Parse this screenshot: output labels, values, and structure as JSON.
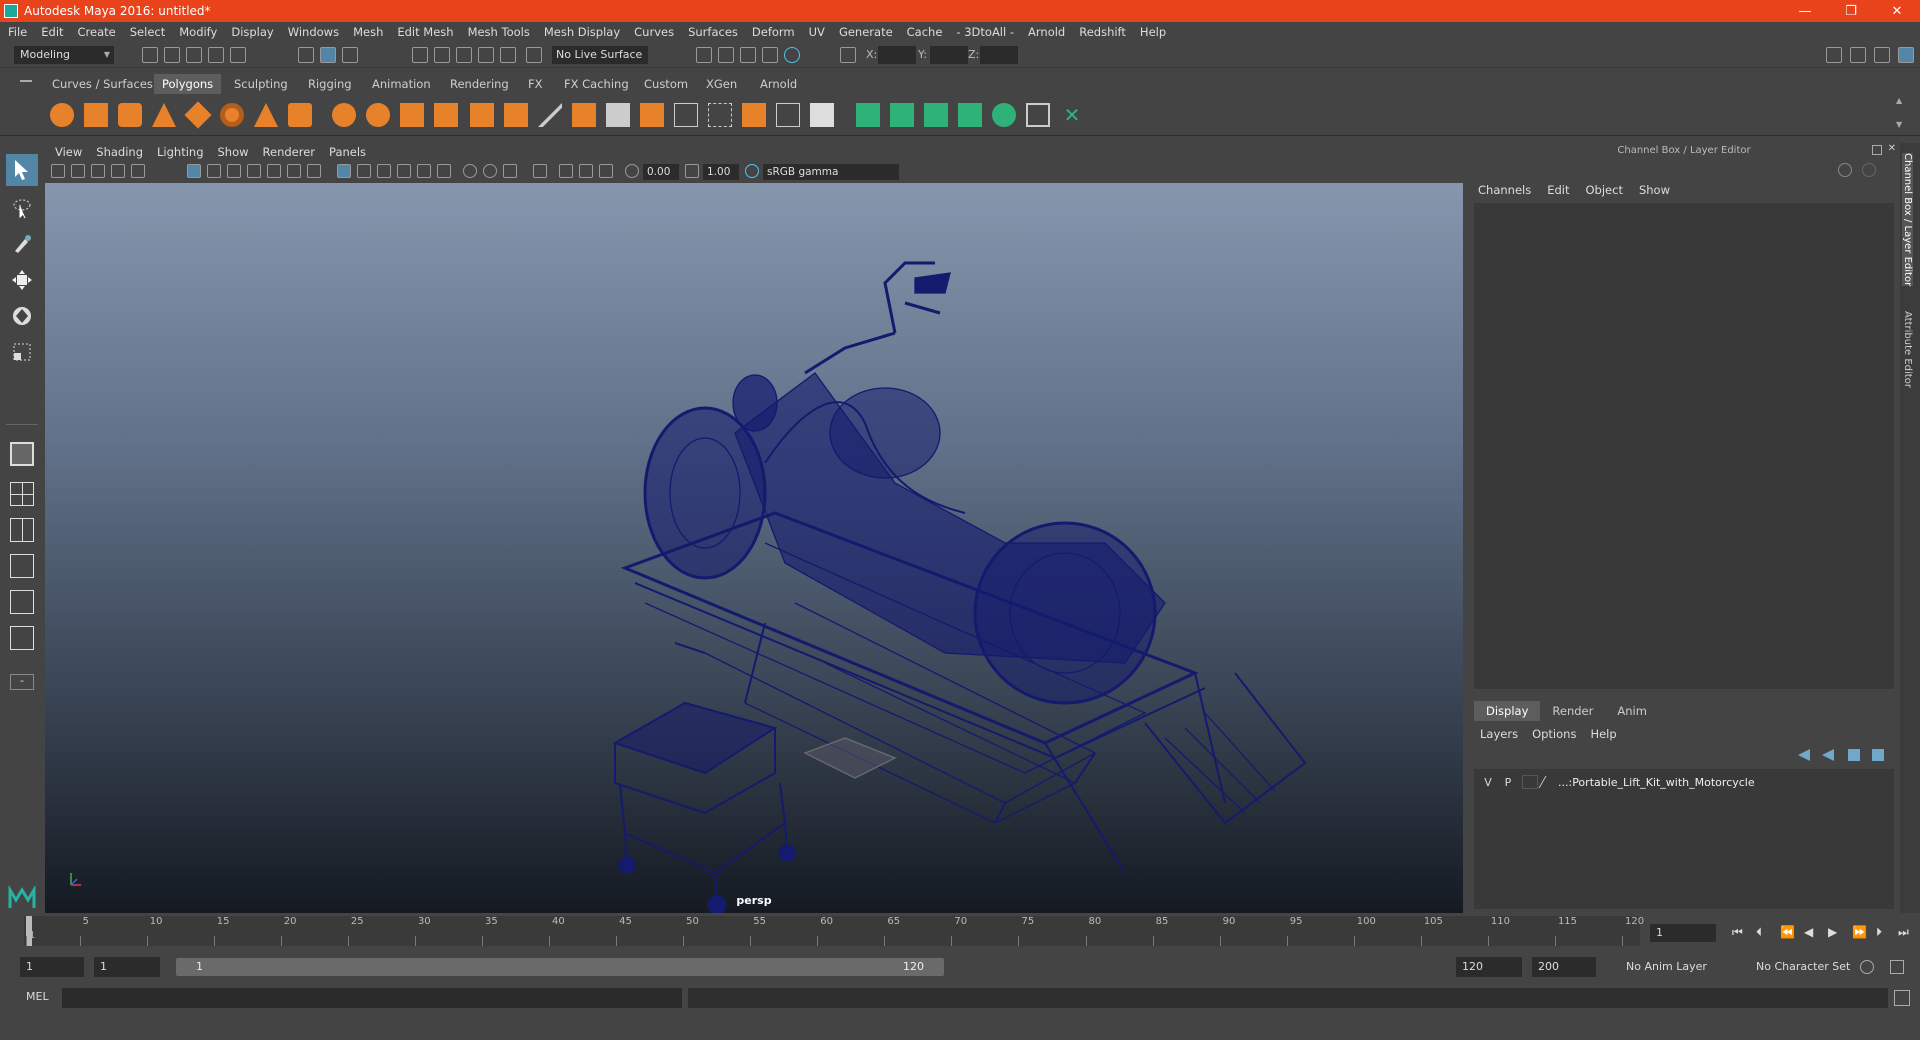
{
  "window": {
    "title": "Autodesk Maya 2016: untitled*",
    "min": "—",
    "restore": "❐",
    "close": "✕"
  },
  "menubar": [
    "File",
    "Edit",
    "Create",
    "Select",
    "Modify",
    "Display",
    "Windows",
    "Mesh",
    "Edit Mesh",
    "Mesh Tools",
    "Mesh Display",
    "Curves",
    "Surfaces",
    "Deform",
    "UV",
    "Generate",
    "Cache",
    "- 3DtoAll -",
    "Arnold",
    "Redshift",
    "Help"
  ],
  "status": {
    "mode": "Modeling",
    "live_surface": "No Live Surface",
    "x_label": "X:",
    "y_label": "Y:",
    "z_label": "Z:"
  },
  "shelf": {
    "tabs": [
      "Curves / Surfaces",
      "Polygons",
      "Sculpting",
      "Rigging",
      "Animation",
      "Rendering",
      "FX",
      "FX Caching",
      "Custom",
      "XGen",
      "Arnold"
    ],
    "active_tab": "Polygons"
  },
  "viewport": {
    "menus": [
      "View",
      "Shading",
      "Lighting",
      "Show",
      "Renderer",
      "Panels"
    ],
    "exposure": "0.00",
    "gamma": "1.00",
    "color_space": "sRGB gamma",
    "camera": "persp"
  },
  "channel_box": {
    "title": "Channel Box / Layer Editor",
    "menus": [
      "Channels",
      "Edit",
      "Object",
      "Show"
    ],
    "layer_tabs": [
      "Display",
      "Render",
      "Anim"
    ],
    "active_layer_tab": "Display",
    "layer_menus": [
      "Layers",
      "Options",
      "Help"
    ],
    "layer": {
      "v": "V",
      "p": "P",
      "name": "...:Portable_Lift_Kit_with_Motorcycle"
    }
  },
  "side_tabs": [
    "Channel Box / Layer Editor",
    "Attribute Editor"
  ],
  "timeline": {
    "ticks": [
      "1",
      "5",
      "10",
      "15",
      "20",
      "25",
      "30",
      "35",
      "40",
      "45",
      "50",
      "55",
      "60",
      "65",
      "70",
      "75",
      "80",
      "85",
      "90",
      "95",
      "100",
      "105",
      "110",
      "115",
      "120"
    ],
    "current_frame": "1"
  },
  "range": {
    "start": "1",
    "anim_start": "1",
    "bar_start": "1",
    "bar_end": "120",
    "anim_end": "120",
    "end": "200",
    "anim_layer": "No Anim Layer",
    "char_set": "No Character Set"
  },
  "command": {
    "label": "MEL"
  }
}
